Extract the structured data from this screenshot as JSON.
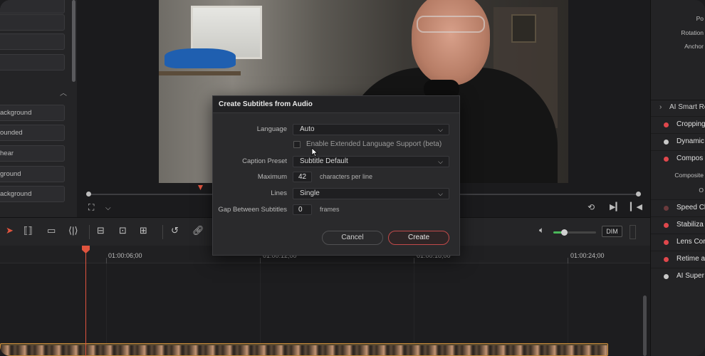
{
  "left_panel": {
    "items": [
      "ackground",
      "ounded",
      "hear",
      "ground",
      "ackground"
    ]
  },
  "viewer": {
    "toolbar_icons": [
      "crop-icon",
      "chevron-down-icon",
      "loop-icon",
      "play-icon",
      "skip-back-icon"
    ]
  },
  "inspector": {
    "transform_labels": [
      "Po",
      "Rotation",
      "Anchor"
    ],
    "section_title": "AI Smart Re",
    "items": [
      {
        "label": "Cropping",
        "state": "on"
      },
      {
        "label": "Dynamic",
        "state": "neutral"
      },
      {
        "label": "Compos",
        "state": "on"
      },
      {
        "label": "Speed Cl",
        "state": "dim"
      },
      {
        "label": "Stabiliza",
        "state": "on"
      },
      {
        "label": "Lens Cor",
        "state": "on"
      },
      {
        "label": "Retime a",
        "state": "on"
      },
      {
        "label": "AI Super",
        "state": "neutral"
      }
    ],
    "composite_labels": [
      "Composite",
      "O"
    ]
  },
  "toolbar": {
    "dim_label": "DIM",
    "volume_level": 0.25
  },
  "timeline": {
    "timecodes": [
      "01:00:06;00",
      "01:00:12;00",
      "01:00:18;00",
      "01:00:24;00"
    ]
  },
  "dialog": {
    "title": "Create Subtitles from Audio",
    "language_label": "Language",
    "language_value": "Auto",
    "extended_label": "Enable Extended Language Support (beta)",
    "caption_preset_label": "Caption Preset",
    "caption_preset_value": "Subtitle Default",
    "maximum_label": "Maximum",
    "maximum_value": "42",
    "maximum_unit": "characters per line",
    "lines_label": "Lines",
    "lines_value": "Single",
    "gap_label": "Gap Between Subtitles",
    "gap_value": "0",
    "gap_unit": "frames",
    "cancel_label": "Cancel",
    "create_label": "Create"
  },
  "colors": {
    "accent_red": "#e0474c",
    "playhead": "#e0543e",
    "clip_border": "#c98b3a",
    "volume_green": "#4ab85a"
  }
}
